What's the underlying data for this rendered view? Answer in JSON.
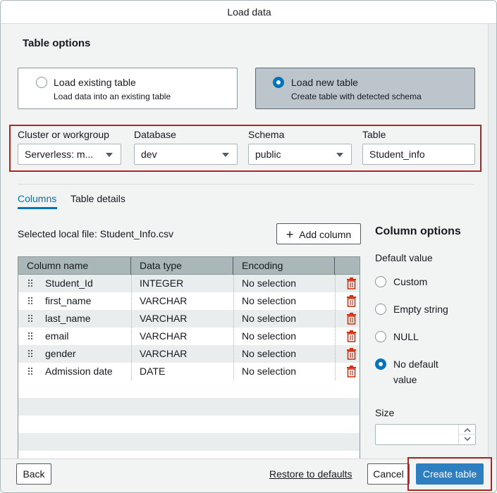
{
  "dialog": {
    "title": "Load data"
  },
  "table_options": {
    "heading": "Table options",
    "existing": {
      "title": "Load existing table",
      "subtitle": "Load data into an existing table"
    },
    "new": {
      "title": "Load new table",
      "subtitle": "Create table with detected schema"
    }
  },
  "fields": {
    "cluster": {
      "label": "Cluster or workgroup",
      "value": "Serverless: m..."
    },
    "database": {
      "label": "Database",
      "value": "dev"
    },
    "schema": {
      "label": "Schema",
      "value": "public"
    },
    "table": {
      "label": "Table",
      "value": "Student_info"
    }
  },
  "tabs": [
    "Columns",
    "Table details"
  ],
  "selected_file": "Selected local file: Student_Info.csv",
  "add_column_label": "Add column",
  "columns_table": {
    "headers": [
      "Column name",
      "Data type",
      "Encoding"
    ],
    "rows": [
      {
        "name": "Student_Id",
        "type": "INTEGER",
        "encoding": "No selection"
      },
      {
        "name": "first_name",
        "type": "VARCHAR",
        "encoding": "No selection"
      },
      {
        "name": "last_name",
        "type": "VARCHAR",
        "encoding": "No selection"
      },
      {
        "name": "email",
        "type": "VARCHAR",
        "encoding": "No selection"
      },
      {
        "name": "gender",
        "type": "VARCHAR",
        "encoding": "No selection"
      },
      {
        "name": "Admission date",
        "type": "DATE",
        "encoding": "No selection"
      }
    ]
  },
  "column_options": {
    "heading": "Column options",
    "default_value_label": "Default value",
    "choices": [
      "Custom",
      "Empty string",
      "NULL",
      "No default",
      "value"
    ],
    "size_label": "Size",
    "size_value": ""
  },
  "footer": {
    "back": "Back",
    "restore": "Restore to defaults",
    "cancel": "Cancel",
    "create": "Create table"
  },
  "colors": {
    "accent": "#0073bb",
    "highlight": "#b0261e",
    "primary": "#2e7fbf",
    "trash": "#d13212"
  }
}
